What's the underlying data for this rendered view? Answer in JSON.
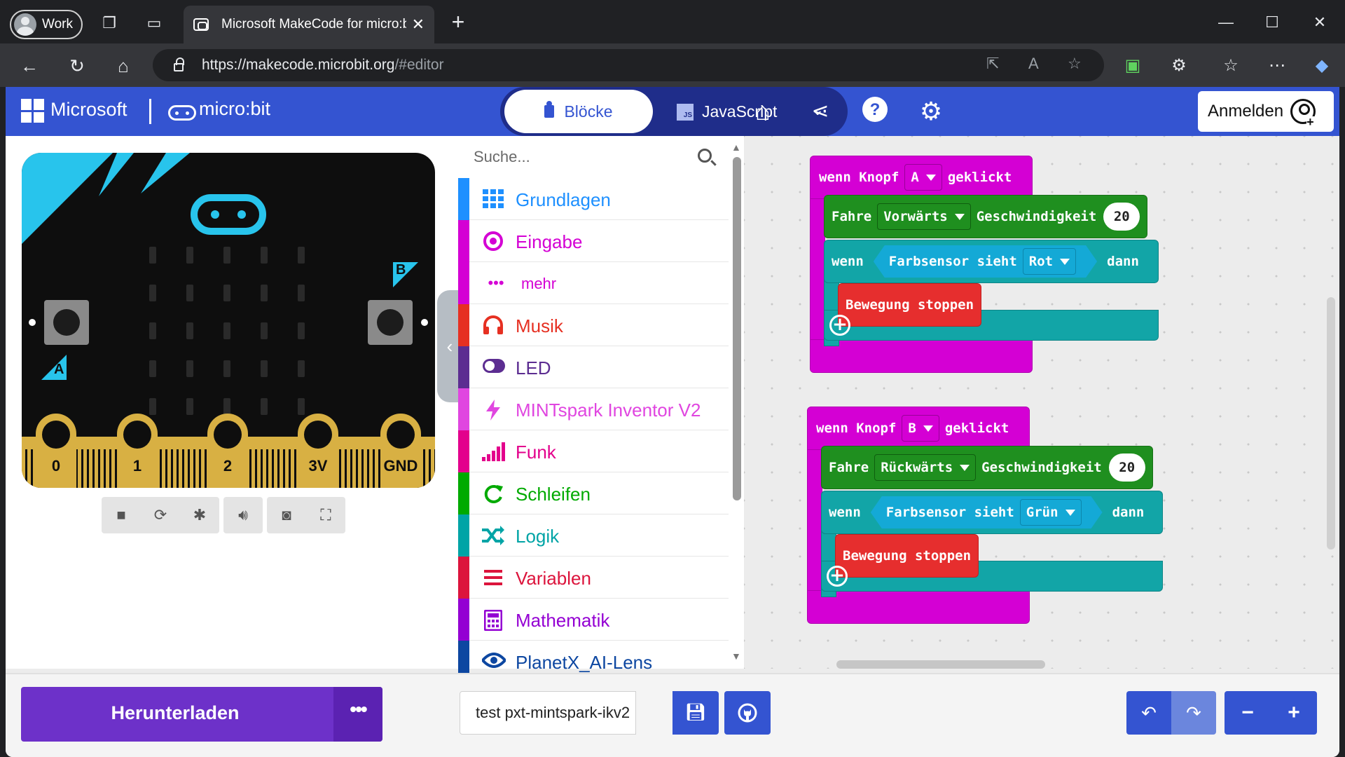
{
  "browser": {
    "profile_label": "Work",
    "tab_title": "Microsoft MakeCode for micro:bit",
    "url_host": "https://makecode.microbit.org",
    "url_path": "/#editor"
  },
  "header": {
    "brand": "Microsoft",
    "product": "micro:bit",
    "mode_blocks": "Blöcke",
    "mode_js": "JavaScript",
    "js_badge": "JS",
    "signin_label": "Anmelden"
  },
  "simulator": {
    "button_a": "A",
    "button_b": "B",
    "pins": [
      "0",
      "1",
      "2",
      "3V",
      "GND"
    ]
  },
  "toolbox": {
    "search_placeholder": "Suche...",
    "categories": [
      {
        "label": "Grundlagen",
        "color": "#1e90ff"
      },
      {
        "label": "Eingabe",
        "color": "#d400d4"
      },
      {
        "label": "mehr",
        "color": "#d400d4"
      },
      {
        "label": "Musik",
        "color": "#e63022"
      },
      {
        "label": "LED",
        "color": "#5c2d91"
      },
      {
        "label": "MINTspark Inventor V2",
        "color": "#e046e0"
      },
      {
        "label": "Funk",
        "color": "#e3008c"
      },
      {
        "label": "Schleifen",
        "color": "#00aa00"
      },
      {
        "label": "Logik",
        "color": "#00a4a6"
      },
      {
        "label": "Variablen",
        "color": "#dc143c"
      },
      {
        "label": "Mathematik",
        "color": "#9400d3"
      },
      {
        "label": "PlanetX_AI-Lens",
        "color": "#0d47a1"
      }
    ]
  },
  "workspace": {
    "group_a": {
      "hat_prefix": "wenn Knopf",
      "button": "A",
      "hat_suffix": "geklickt",
      "drive": "Fahre",
      "direction": "Vorwärts",
      "speed_label": "Geschwindigkeit",
      "speed": "20",
      "if_label": "wenn",
      "sensor": "Farbsensor sieht",
      "color": "Rot",
      "then": "dann",
      "stop": "Bewegung stoppen"
    },
    "group_b": {
      "hat_prefix": "wenn Knopf",
      "button": "B",
      "hat_suffix": "geklickt",
      "drive": "Fahre",
      "direction": "Rückwärts",
      "speed_label": "Geschwindigkeit",
      "speed": "20",
      "if_label": "wenn",
      "sensor": "Farbsensor sieht",
      "color": "Grün",
      "then": "dann",
      "stop": "Bewegung stoppen"
    }
  },
  "bottom": {
    "download_label": "Herunterladen",
    "project_name": "test pxt-mintspark-ikv2"
  }
}
